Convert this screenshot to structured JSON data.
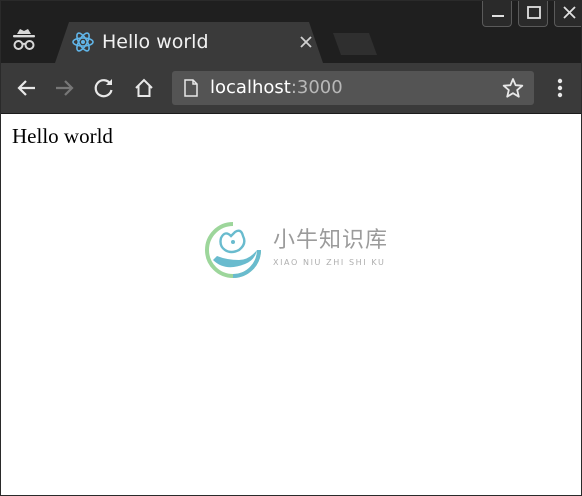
{
  "window": {
    "buttons": [
      "minimize",
      "maximize",
      "close"
    ]
  },
  "tabstrip": {
    "incognito_icon": "incognito-icon",
    "active_tab": {
      "title": "Hello world",
      "favicon": "react-atom-icon",
      "close_icon": "close-icon"
    },
    "new_tab_icon": "new-tab-icon"
  },
  "toolbar": {
    "back_icon": "back-arrow-icon",
    "forward_icon": "forward-arrow-icon",
    "reload_icon": "reload-icon",
    "home_icon": "home-icon",
    "address": {
      "page_icon": "page-icon",
      "host": "localhost",
      "port": ":3000"
    },
    "bookmark_icon": "star-icon",
    "menu_icon": "kebab-menu-icon"
  },
  "page": {
    "text": "Hello world"
  },
  "watermark": {
    "text_cn": "小牛知识库",
    "text_en": "XIAO NIU ZHI SHI KU"
  },
  "colors": {
    "tabstrip_bg": "#1f1f1f",
    "tab_bg": "#3a3a3a",
    "toolbar_bg": "#3a3a3a",
    "omnibox_bg": "#545454",
    "favicon": "#61b5e8",
    "watermark_teal": "#4fb0c6",
    "watermark_green": "#8ccf8a"
  }
}
